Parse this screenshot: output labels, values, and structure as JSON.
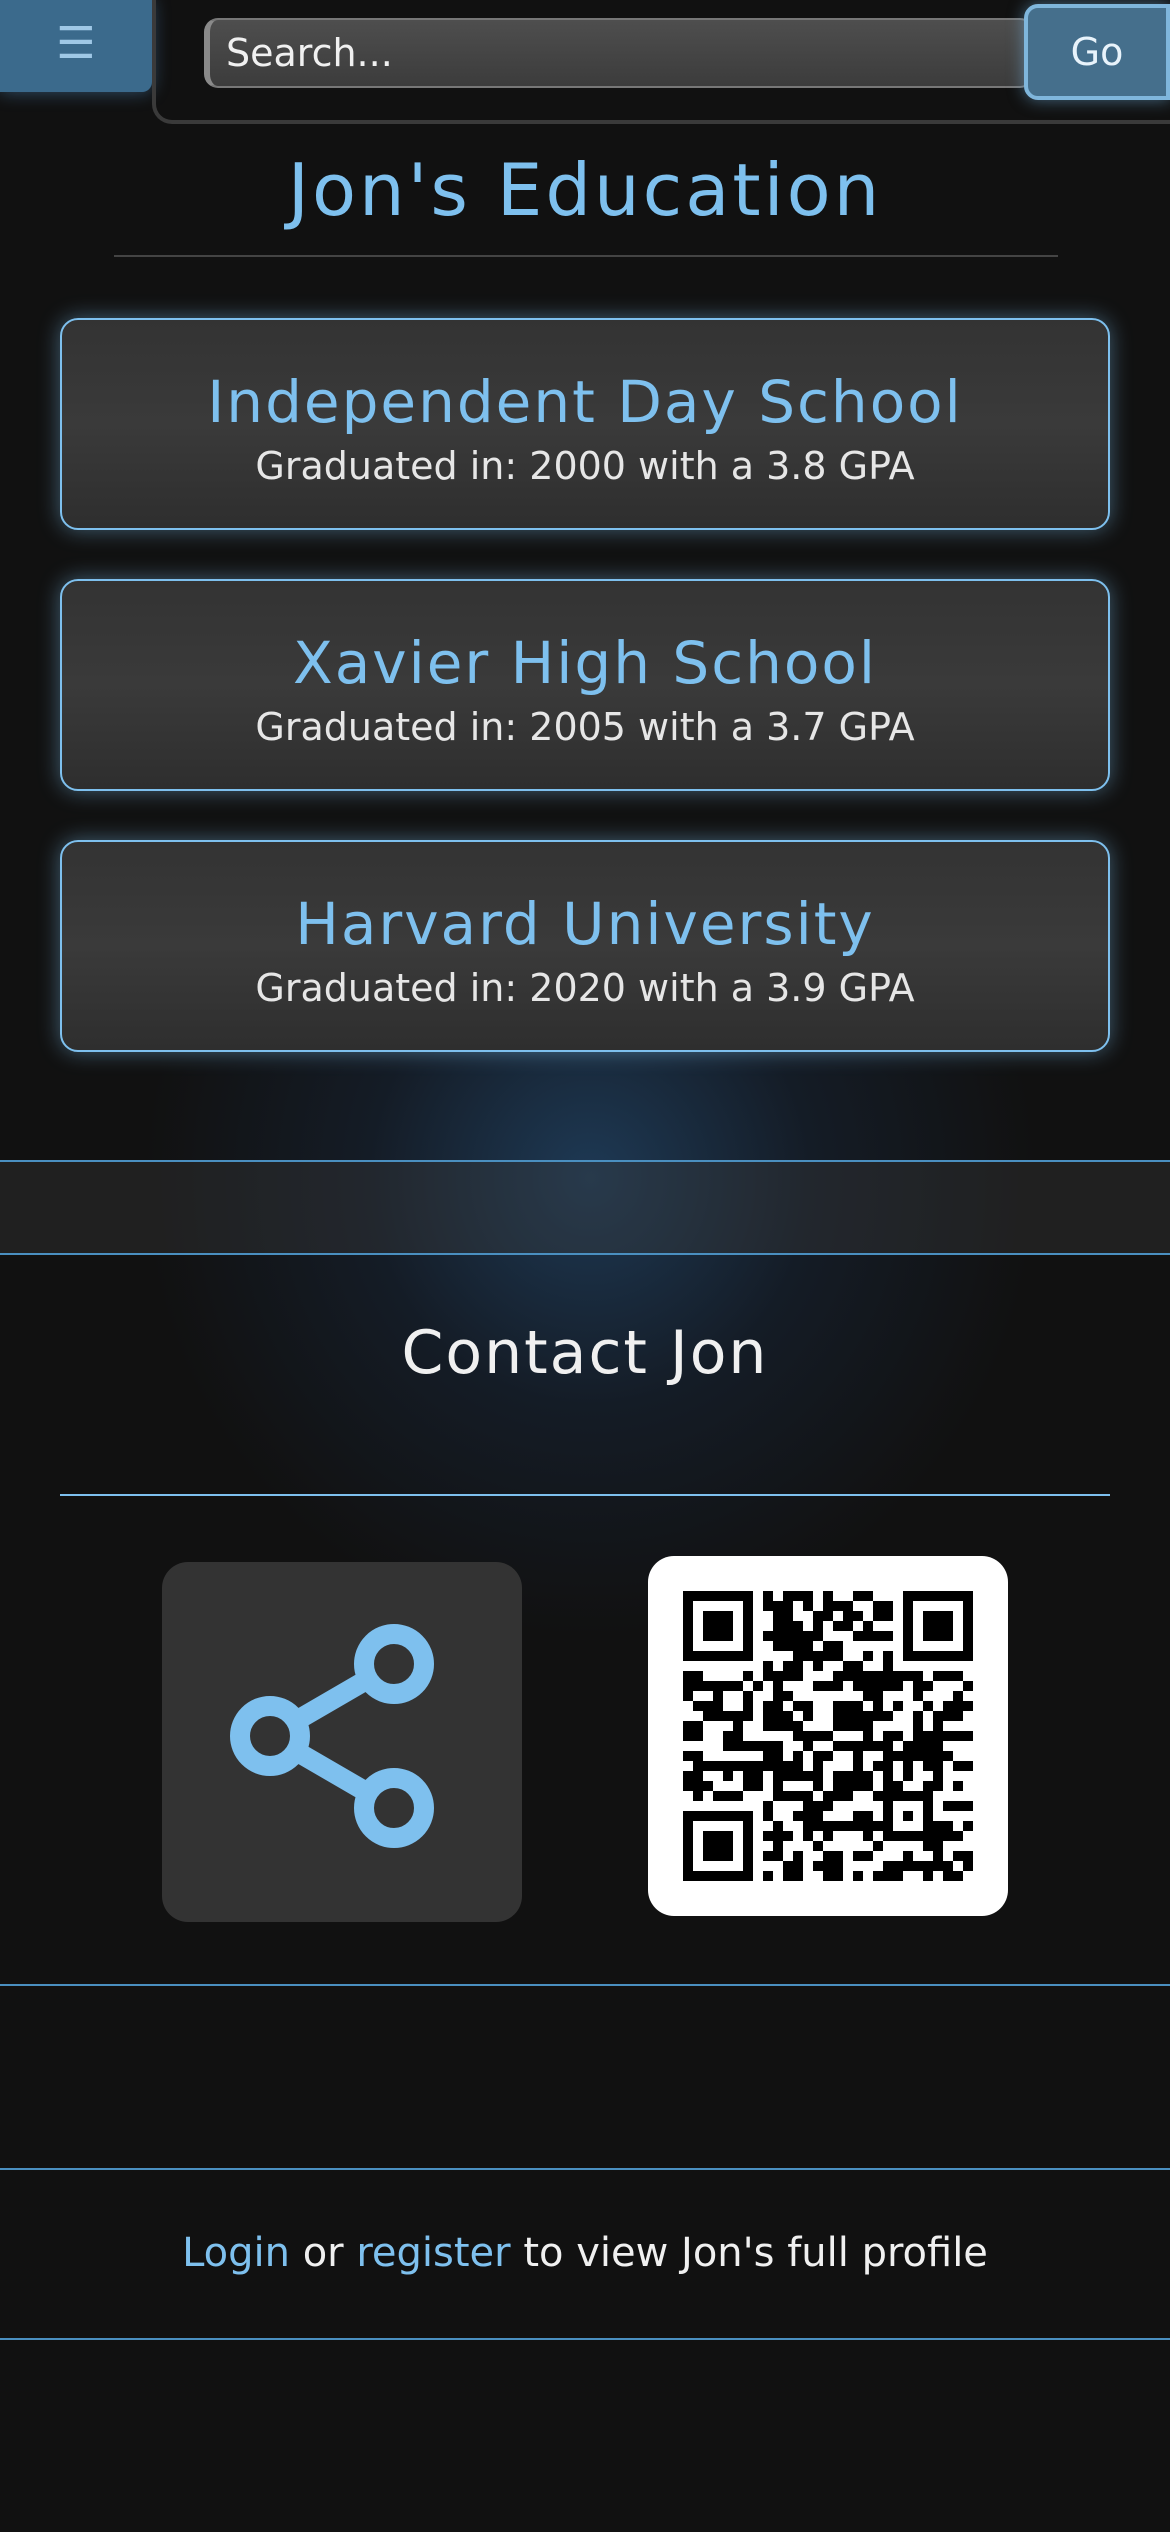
{
  "header": {
    "menu_icon": "hamburger-menu-icon",
    "menu_glyph": "☰",
    "search_placeholder": "Search...",
    "go_label": "Go"
  },
  "page_title": "Jon's Education",
  "education": [
    {
      "school": "Independent Day School",
      "detail": "Graduated in: 2000 with a 3.8 GPA"
    },
    {
      "school": "Xavier High School",
      "detail": "Graduated in: 2005 with a 3.7 GPA"
    },
    {
      "school": "Harvard University",
      "detail": "Graduated in: 2020 with a 3.9 GPA"
    }
  ],
  "contact": {
    "title": "Contact Jon",
    "share_icon": "share-icon",
    "qr_icon": "qr-code-icon"
  },
  "footer": {
    "login_label": "Login",
    "or_text": " or ",
    "register_label": "register",
    "suffix_text": " to view Jon's full profile"
  },
  "colors": {
    "accent": "#7ec0ee",
    "background": "#111111",
    "card": "#363636"
  }
}
